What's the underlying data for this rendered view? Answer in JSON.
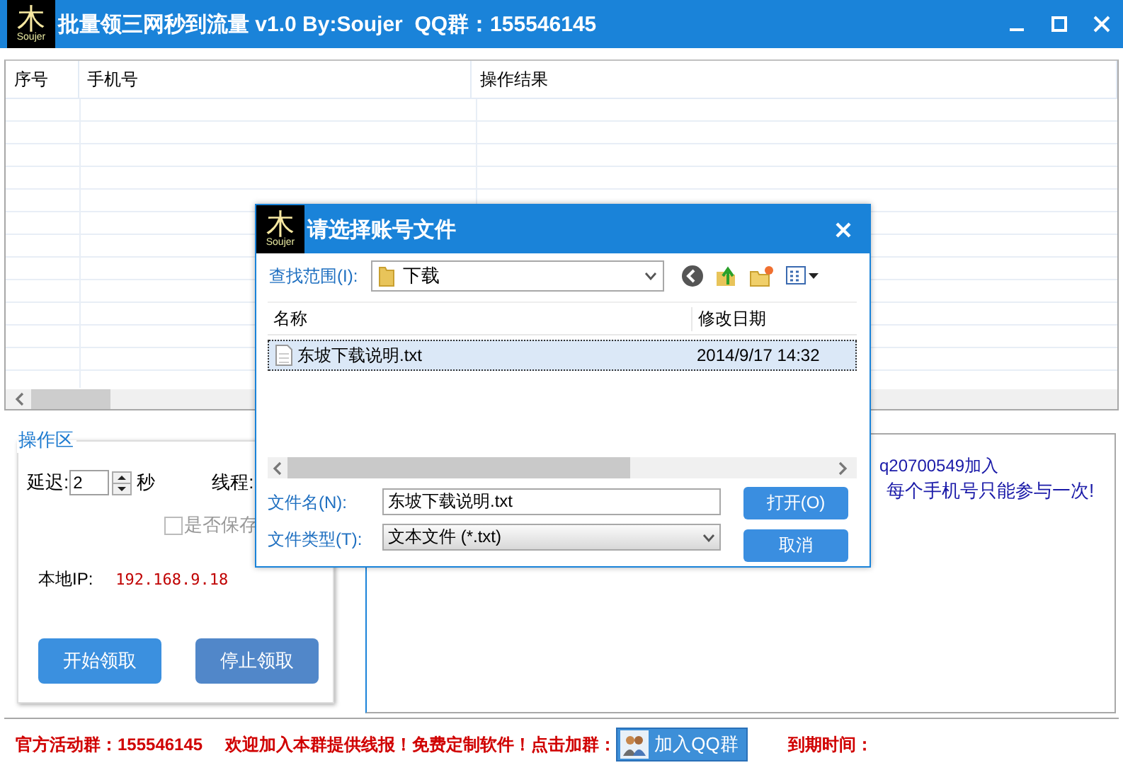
{
  "window": {
    "logo": {
      "glyph": "木",
      "caption": "Soujer"
    },
    "title": "批量领三网秒到流量 v1.0 By:Soujer  QQ群：155546145"
  },
  "table": {
    "columns": [
      "序号",
      "手机号",
      "操作结果"
    ]
  },
  "operation_panel": {
    "title": "操作区",
    "delay_label": "延迟:",
    "delay_value": "2",
    "delay_unit": "秒",
    "threads_label": "线程:",
    "save_checkbox": {
      "label": "是否保存",
      "checked": false
    },
    "local_ip_label": "本地IP:",
    "local_ip": "192.168.9.18",
    "buttons": [
      "开始领取",
      "停止领取"
    ]
  },
  "log": {
    "lines": [
      "q20700549加入",
      "每个手机号只能参与一次!"
    ]
  },
  "status_bar": {
    "group_text": "官方活动群：155546145",
    "notice": "欢迎加入本群提供线报！免费定制软件！点击加群：",
    "join_button": "加入QQ群",
    "expiry_label": "到期时间："
  },
  "dialog": {
    "logo": {
      "glyph": "木",
      "caption": "Soujer"
    },
    "title": "请选择账号文件",
    "look_in_label": "查找范围(I):",
    "look_in": "下载",
    "columns": [
      "名称",
      "修改日期"
    ],
    "files": [
      {
        "name": "东坡下载说明.txt",
        "modified": "2014/9/17 14:32",
        "selected": true
      }
    ],
    "file_name_label": "文件名(N):",
    "file_name": "东坡下载说明.txt",
    "file_type_label": "文件类型(T):",
    "file_type": "文本文件 (*.txt)",
    "buttons": [
      "打开(O)",
      "取消"
    ]
  }
}
